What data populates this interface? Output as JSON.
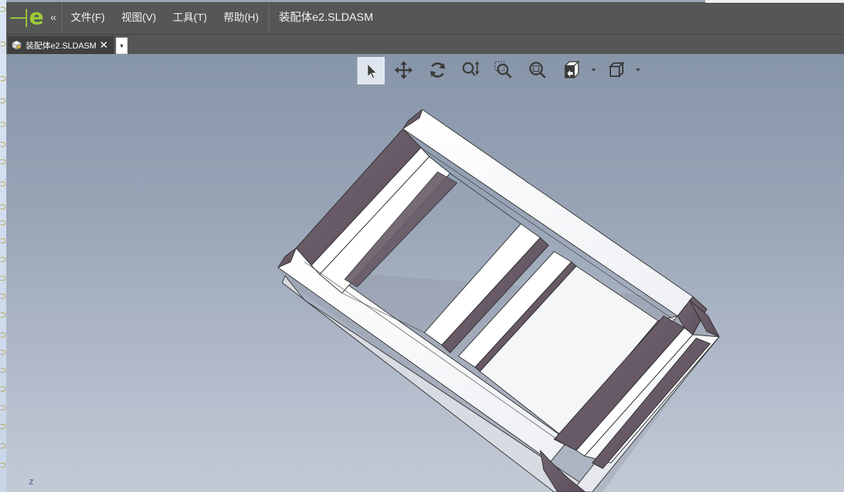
{
  "app": {
    "menu": [
      {
        "label": "文件(F)"
      },
      {
        "label": "视图(V)"
      },
      {
        "label": "工具(T)"
      },
      {
        "label": "帮助(H)"
      }
    ],
    "title": "装配体e2.SLDASM"
  },
  "tabs": [
    {
      "label": "装配体e2.SLDASM",
      "close": "✕"
    }
  ],
  "toolbar": {
    "tools": [
      {
        "name": "select",
        "icon": "select-arrow-icon"
      },
      {
        "name": "pan",
        "icon": "pan-icon"
      },
      {
        "name": "rotate",
        "icon": "rotate-icon"
      },
      {
        "name": "zoom",
        "icon": "zoom-updown-icon"
      },
      {
        "name": "zoom-area",
        "icon": "zoom-area-icon"
      },
      {
        "name": "zoom-fit",
        "icon": "zoom-fit-icon"
      },
      {
        "name": "view-orientation",
        "icon": "view-orientation-icon"
      },
      {
        "name": "display-style",
        "icon": "display-style-icon"
      }
    ]
  },
  "triad": {
    "label": "Z"
  },
  "colors": {
    "chrome": "#555756",
    "logo": "#9ccc3a",
    "frame_light": "#f8f9fb",
    "frame_dark": "#6a5b68"
  }
}
